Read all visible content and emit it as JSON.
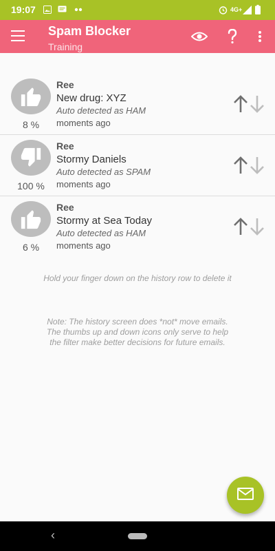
{
  "status_bar": {
    "time": "19:07",
    "network": "4G+"
  },
  "app_bar": {
    "title": "Spam Blocker",
    "subtitle": "Training",
    "icons": [
      "menu-icon",
      "eye-icon",
      "help-icon",
      "more-vert-icon"
    ]
  },
  "history": [
    {
      "verdict": "HAM",
      "icon": "thumbs-up-icon",
      "percent": "8 %",
      "sender": "Ree",
      "subject": "New drug: XYZ",
      "detection": "Auto detected as HAM",
      "time": "moments ago"
    },
    {
      "verdict": "SPAM",
      "icon": "thumbs-down-icon",
      "percent": "100 %",
      "sender": "Ree",
      "subject": "Stormy Daniels",
      "detection": "Auto detected as SPAM",
      "time": "moments ago"
    },
    {
      "verdict": "HAM",
      "icon": "thumbs-up-icon",
      "percent": "6 %",
      "sender": "Ree",
      "subject": "Stormy at Sea Today",
      "detection": "Auto detected as HAM",
      "time": "moments ago"
    }
  ],
  "hints": {
    "delete_hint": "Hold your finger down on the history row to delete it",
    "note": "Note: The history screen does *not* move emails. The thumbs up and down icons only serve to help the filter make better decisions for future emails."
  },
  "fab": {
    "icon": "mail-icon"
  },
  "colors": {
    "status_bar": "#a8c226",
    "app_bar": "#f0647a",
    "fab": "#a8c226",
    "thumb_bg": "#bdbdbd"
  }
}
